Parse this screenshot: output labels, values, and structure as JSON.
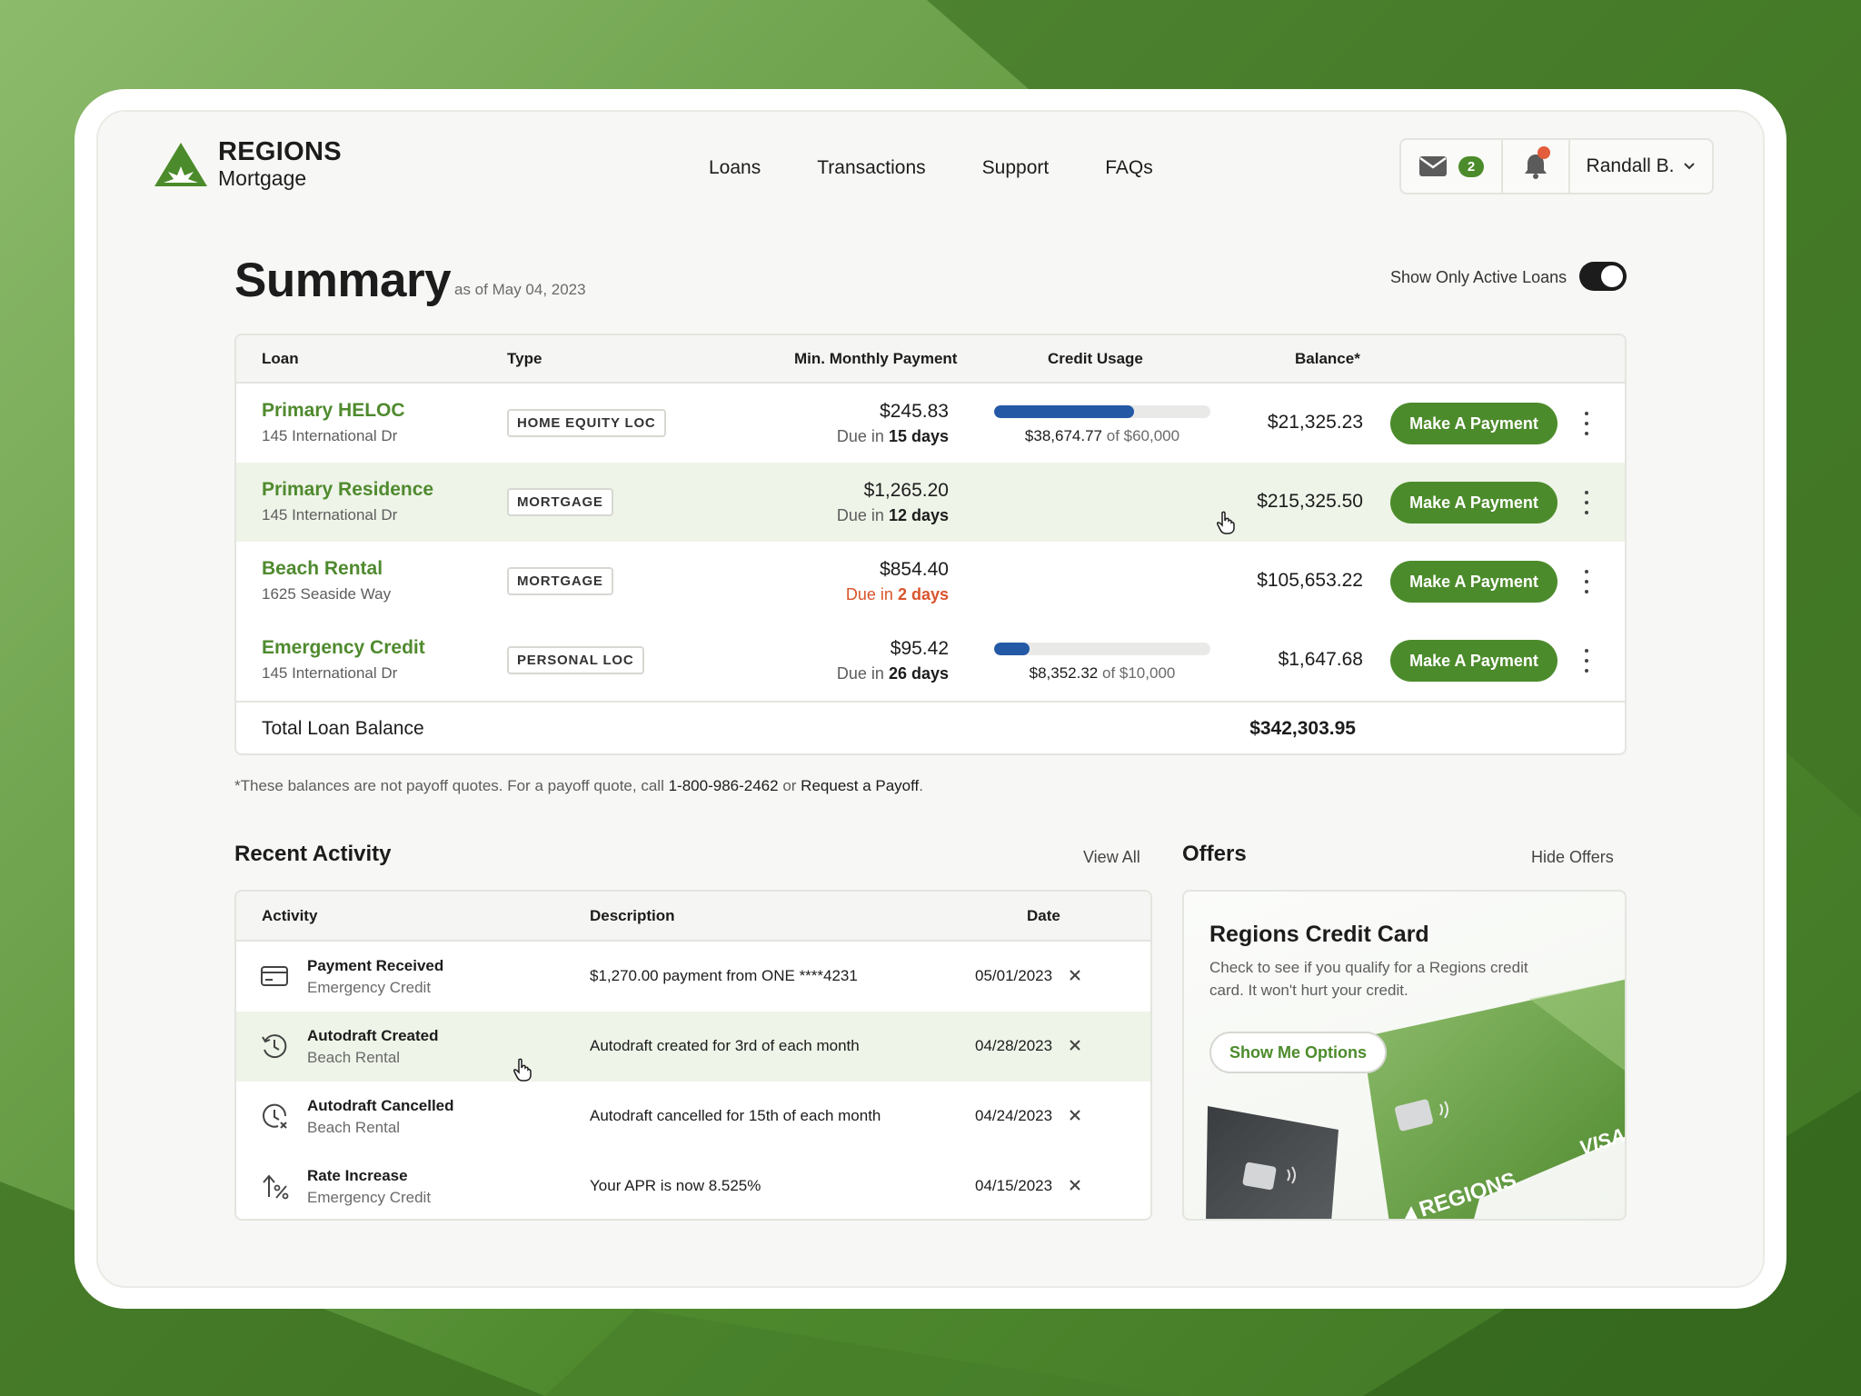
{
  "brand": {
    "name": "REGIONS",
    "sub": "Mortgage"
  },
  "nav": [
    "Loans",
    "Transactions",
    "Support",
    "FAQs"
  ],
  "header": {
    "mail_count": "2",
    "user_name": "Randall B."
  },
  "summary": {
    "title": "Summary",
    "as_of": "as of May 04, 2023",
    "toggle_label": "Show Only Active Loans",
    "toggle_on": true
  },
  "loans_table": {
    "headers": [
      "Loan",
      "Type",
      "Min. Monthly Payment",
      "Credit Usage",
      "Balance*"
    ],
    "rows": [
      {
        "name": "Primary HELOC",
        "address": "145 International Dr",
        "type": "HOME EQUITY LOC",
        "payment": "$245.83",
        "due_prefix": "Due in",
        "due_days": "15 days",
        "urgent": false,
        "usage_used": "$38,674.77",
        "usage_of": "of $60,000",
        "usage_fraction": 0.645,
        "balance": "$21,325.23",
        "action": "Make A Payment"
      },
      {
        "name": "Primary Residence",
        "address": "145 International Dr",
        "type": "MORTGAGE",
        "payment": "$1,265.20",
        "due_prefix": "Due in",
        "due_days": "12 days",
        "urgent": false,
        "balance": "$215,325.50",
        "action": "Make A Payment"
      },
      {
        "name": "Beach Rental",
        "address": "1625 Seaside Way",
        "type": "MORTGAGE",
        "payment": "$854.40",
        "due_prefix": "Due in",
        "due_days": "2 days",
        "urgent": true,
        "balance": "$105,653.22",
        "action": "Make A Payment"
      },
      {
        "name": "Emergency Credit",
        "address": "145 International Dr",
        "type": "PERSONAL LOC",
        "payment": "$95.42",
        "due_prefix": "Due in",
        "due_days": "26 days",
        "urgent": false,
        "usage_used": "$8,352.32",
        "usage_of": "of $10,000",
        "usage_fraction": 0.165,
        "balance": "$1,647.68",
        "action": "Make A Payment"
      }
    ],
    "total_label": "Total Loan Balance",
    "total_value": "$342,303.95"
  },
  "footnote": {
    "text": "*These balances are not payoff quotes. For a payoff quote, call",
    "phone": "1-800-986-2462",
    "or": "or",
    "link": "Request a Payoff",
    "end": "."
  },
  "activity": {
    "title": "Recent Activity",
    "view_all": "View All",
    "headers": [
      "Activity",
      "Description",
      "Date"
    ],
    "rows": [
      {
        "icon": "card-icon",
        "title": "Payment Received",
        "sub": "Emergency Credit",
        "desc": "$1,270.00 payment from ONE ****4231",
        "date": "05/01/2023"
      },
      {
        "icon": "clock-repeat-icon",
        "title": "Autodraft Created",
        "sub": "Beach Rental",
        "desc": "Autodraft created for 3rd of each month",
        "date": "04/28/2023"
      },
      {
        "icon": "clock-cancel-icon",
        "title": "Autodraft Cancelled",
        "sub": "Beach Rental",
        "desc": "Autodraft cancelled for 15th of each month",
        "date": "04/24/2023"
      },
      {
        "icon": "rate-up-icon",
        "title": "Rate Increase",
        "sub": "Emergency Credit",
        "desc": "Your APR is now 8.525%",
        "date": "04/15/2023"
      }
    ]
  },
  "offers": {
    "title": "Offers",
    "hide": "Hide Offers",
    "card_title": "Regions Credit Card",
    "card_text": "Check to see if you qualify for a Regions credit card. It won't hurt your credit.",
    "button": "Show Me Options",
    "card_brand": "REGIONS",
    "card_network": "VISA"
  },
  "colors": {
    "brand_green": "#4c8b2b",
    "usage_blue": "#2459a6",
    "urgent_red": "#d9542c",
    "row_highlight": "#eef4e8"
  }
}
